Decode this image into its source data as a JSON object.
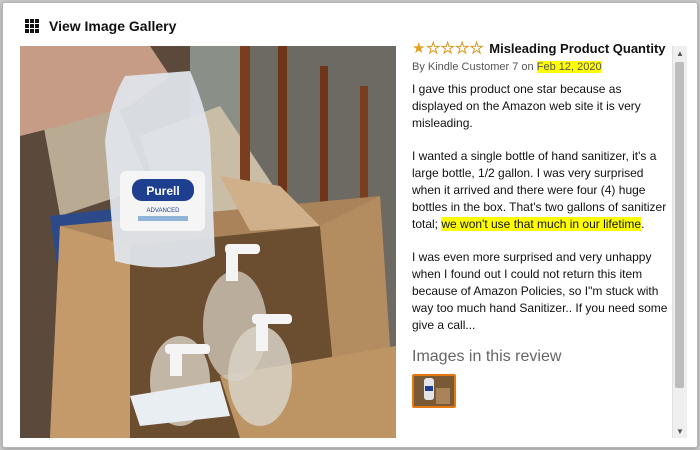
{
  "header": {
    "title": "View Image Gallery"
  },
  "review": {
    "rating": 1,
    "max_rating": 5,
    "title": "Misleading Product Quantity",
    "by_prefix": "By Kindle Customer 7 on",
    "date": "Feb 12, 2020",
    "paragraph1": "I gave this product one star because as displayed on the Amazon web site it is very misleading.",
    "paragraph2_main": "I wanted a single bottle of hand sanitizer, it's a large bottle, 1/2 gallon. I was very surprised when it arrived and there were four (4) huge bottles in the box. That's two gallons of sanitizer total; ",
    "paragraph2_highlight": "we won't use that much in our lifetime",
    "paragraph2_end": ".",
    "paragraph3": "I was even more surprised and very unhappy when I found out I could not return this item because of Amazon Policies, so I\"m stuck with way too much hand Sanitizer.. If you need some give a call...",
    "images_heading": "Images in this review"
  },
  "photo": {
    "bottle_brand": "Purell",
    "bottle_subtitle": "ADVANCED"
  },
  "colors": {
    "highlight": "#ffff00",
    "star": "#e3a01e",
    "thumb_border": "#e47911"
  }
}
